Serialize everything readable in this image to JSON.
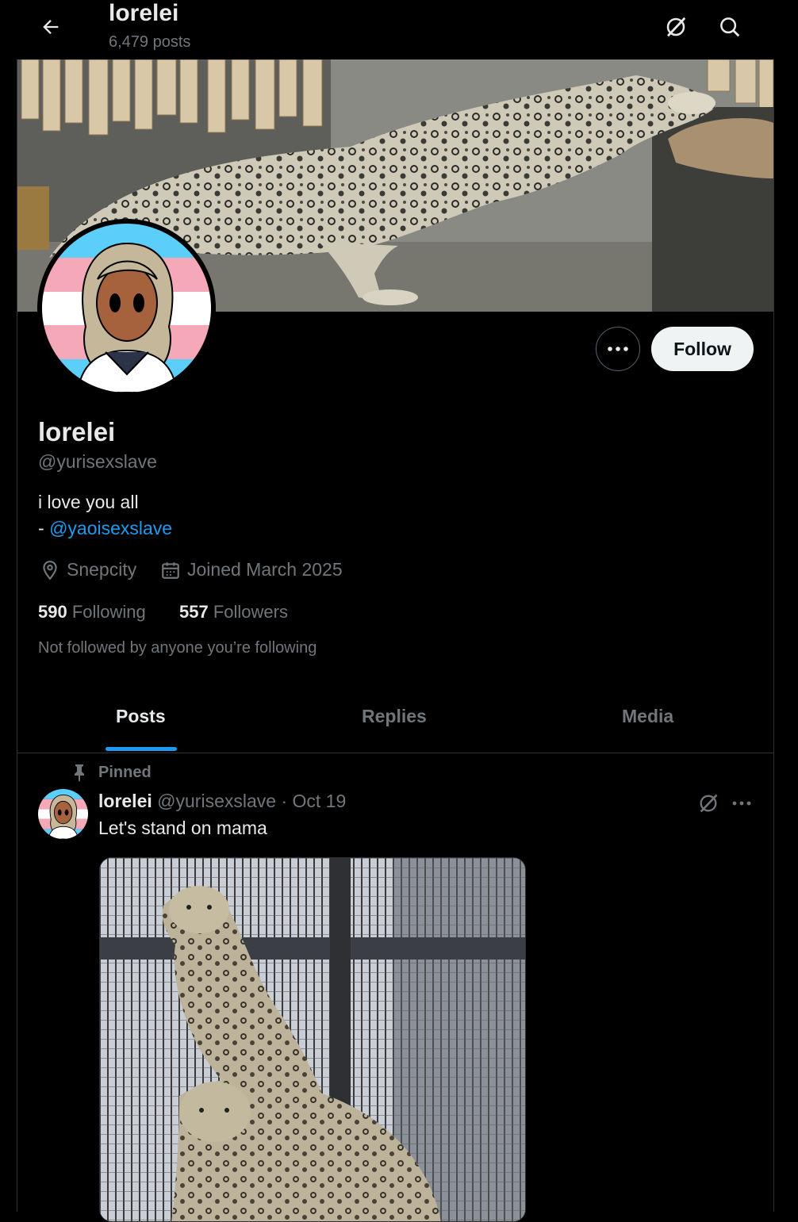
{
  "header": {
    "name": "lorelei",
    "post_count": "6,479 posts"
  },
  "profile": {
    "display_name": "lorelei",
    "handle": "@yurisexslave",
    "bio_line1": "i love you all",
    "bio_prefix": "- ",
    "bio_mention": "@yaoisexslave",
    "location": "Snepcity",
    "joined": "Joined March 2025",
    "following_count": "590",
    "following_label": "Following",
    "followers_count": "557",
    "followers_label": "Followers",
    "not_followed_text": "Not followed by anyone you’re following",
    "follow_label": "Follow"
  },
  "tabs": [
    {
      "label": "Posts",
      "active": true
    },
    {
      "label": "Replies",
      "active": false
    },
    {
      "label": "Media",
      "active": false
    }
  ],
  "pinned_post": {
    "pinned_label": "Pinned",
    "author": "lorelei",
    "handle": "@yurisexslave",
    "separator": "·",
    "date": "Oct 19",
    "text": "Let's stand on mama"
  },
  "icons": {
    "back": "arrow-left-icon",
    "grok": "slash-circle-icon",
    "search": "search-icon",
    "more": "more-dots-icon",
    "location": "location-pin-icon",
    "calendar": "calendar-icon",
    "pin": "pin-icon"
  },
  "colors": {
    "accent": "#1d9bf0",
    "background": "#000000",
    "primary_text": "#e7e9ea",
    "secondary_text": "#71767b",
    "border": "#2f3336"
  }
}
